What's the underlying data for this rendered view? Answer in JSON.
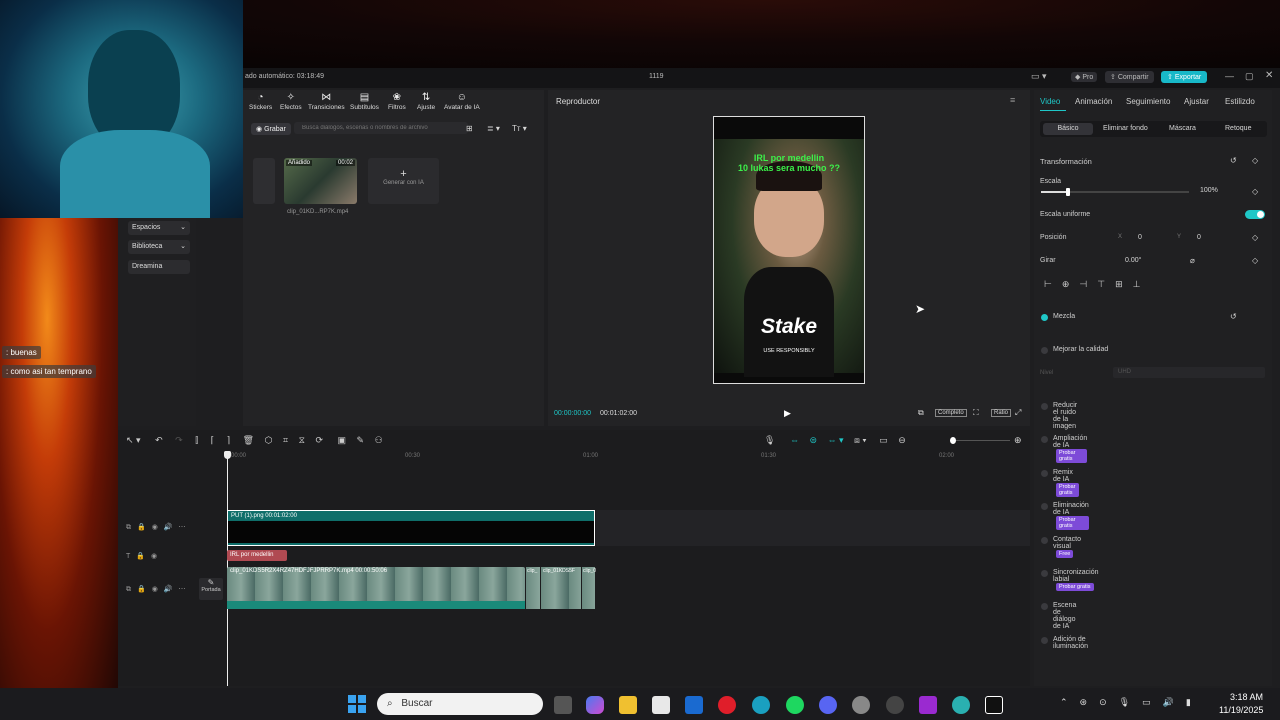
{
  "titlebar": {
    "left_text": "ado automático: 03:18:49",
    "center_text": "1119",
    "pro_label": "Pro",
    "share_label": "Compartir",
    "export_label": "Exportar"
  },
  "toolbar": {
    "items": [
      "Stickers",
      "Efectos",
      "Transiciones",
      "Subtítulos",
      "Filtros",
      "Ajuste",
      "Avatar de IA"
    ]
  },
  "media": {
    "record_label": "Grabar",
    "search_placeholder": "Busca diálogos, escenas o nombres de archivo",
    "clip_badge": "Añadido",
    "clip_duration": "00:02",
    "clip_name": "clip_01KD...RP7K.mp4",
    "generate_label": "Generar con IA"
  },
  "sidebar": {
    "items": [
      "Espacios",
      "Biblioteca",
      "Dreamina"
    ]
  },
  "chat": {
    "messages": [
      ": buenas",
      ": como asi tan temprano"
    ]
  },
  "player": {
    "title": "Reproductor",
    "current_time": "00:00:00:00",
    "total_time": "00:01:02:00",
    "complete_label": "Completo",
    "ratio_label": "Ratio",
    "overlay_line1": "IRL por medellin",
    "overlay_line2": "10 lukas sera mucho ??",
    "watermark_main": "Stake",
    "watermark_sub": "USE RESPONSIBLY"
  },
  "timeline": {
    "ruler": [
      "00:00",
      "00:30",
      "01:00",
      "01:30",
      "02:00"
    ],
    "overlay_clip": "PUT (1).png  00:01:02:00",
    "text_clip": "IRL por medellin",
    "main_clip": "clip_01KDS5R2X4RZ47HDFJFJPRRP7K.mp4  00:00:50:06",
    "side_clip_1": "clip_",
    "side_clip_2": "clip_01KDS5F",
    "side_clip_3": "clip_0",
    "cover_label": "Portada"
  },
  "props": {
    "tabs": [
      "Video",
      "Animación",
      "Seguimiento",
      "Ajustar",
      "Estilizdo"
    ],
    "subtabs": [
      "Básico",
      "Eliminar fondo",
      "Máscara",
      "Retoque"
    ],
    "transform_label": "Transformación",
    "scale_label": "Escala",
    "scale_value": "100%",
    "scale_level": 0.18,
    "uniform_label": "Escala uniforme",
    "position_label": "Posición",
    "pos_x_label": "X",
    "pos_x": "0",
    "pos_y_label": "Y",
    "pos_y": "0",
    "rotate_label": "Girar",
    "rotate_value": "0.00°",
    "blend_label": "Mezcla",
    "quality_label": "Mejorar la calidad",
    "quality_level_label": "Nivel",
    "quality_level_value": "UHD",
    "features": [
      {
        "label": "Reducir el ruido de la imagen",
        "badge": ""
      },
      {
        "label": "Ampliación de IA",
        "badge": "Probar gratis"
      },
      {
        "label": "Remix de IA",
        "badge": "Probar gratis"
      },
      {
        "label": "Eliminación de IA",
        "badge": "Probar gratis"
      },
      {
        "label": "Contacto visual",
        "badge": "Free"
      },
      {
        "label": "Sincronización labial",
        "badge": "Probar gratis"
      },
      {
        "label": "Escena de diálogo de IA",
        "badge": ""
      },
      {
        "label": "Adición de iluminación",
        "badge": ""
      }
    ]
  },
  "taskbar": {
    "search_label": "Buscar",
    "time": "3:18 AM",
    "date": "11/19/2025"
  },
  "colors": {
    "accent": "#1fc7c7",
    "export_bg": "#18b8c8",
    "badge": "#7d4bd8"
  }
}
